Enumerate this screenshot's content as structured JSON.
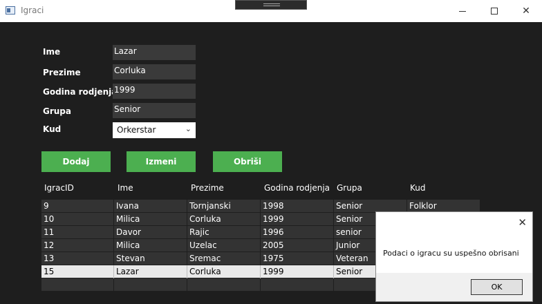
{
  "window": {
    "title": "Igraci",
    "icon": "app-window-icon"
  },
  "form": {
    "labels": {
      "ime": "Ime",
      "prezime": "Prezime",
      "godina": "Godina rodjenja",
      "grupa": "Grupa",
      "kud": "Kud"
    },
    "values": {
      "ime": "Lazar",
      "prezime": "Corluka",
      "godina": "1999",
      "grupa": "Senior",
      "kud": "Orkerstar"
    }
  },
  "buttons": {
    "dodaj": "Dodaj",
    "izmeni": "Izmeni",
    "obrisi": "Obriši"
  },
  "grid": {
    "columns": [
      "IgracID",
      "Ime",
      "Prezime",
      "Godina rodjenja",
      "Grupa",
      "Kud"
    ],
    "rows": [
      [
        "9",
        "Ivana",
        "Tornjanski",
        "1998",
        "Senior",
        "Folklor"
      ],
      [
        "10",
        "Milica",
        "Corluka",
        "1999",
        "Senior",
        ""
      ],
      [
        "11",
        "Davor",
        "Rajic",
        "1996",
        "senior",
        ""
      ],
      [
        "12",
        "Milica",
        "Uzelac",
        "2005",
        "Junior",
        ""
      ],
      [
        "13",
        "Stevan",
        "Sremac",
        "1975",
        "Veteran",
        ""
      ],
      [
        "15",
        "Lazar",
        "Corluka",
        "1999",
        "Senior",
        ""
      ],
      [
        "",
        "",
        "",
        "",
        "",
        ""
      ]
    ],
    "selected_row": 5
  },
  "dialog": {
    "message": "Podaci o igracu su uspešno obrisani",
    "ok": "OK"
  },
  "colors": {
    "accent": "#4caf50",
    "background": "#1e1e1e",
    "row": "#333333",
    "selected_row": "#e9e9e9"
  }
}
